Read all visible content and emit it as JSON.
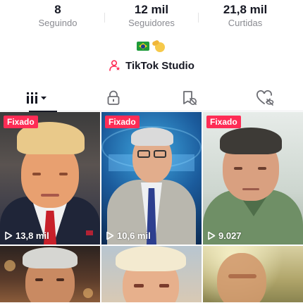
{
  "stats": [
    {
      "value": "8",
      "label": "Seguindo"
    },
    {
      "value": "12 mil",
      "label": "Seguidores"
    },
    {
      "value": "21,8 mil",
      "label": "Curtidas"
    }
  ],
  "bio_emojis": [
    "brazil-flag",
    "saluting-face"
  ],
  "studio": {
    "label": "TikTok Studio",
    "icon": "person-star-icon",
    "icon_color": "#fe2c55"
  },
  "tabs": [
    {
      "name": "videos",
      "icon": "grid-dropdown-icon",
      "active": true
    },
    {
      "name": "private",
      "icon": "lock-icon",
      "active": false
    },
    {
      "name": "reposts",
      "icon": "repost-icon",
      "active": false
    },
    {
      "name": "liked",
      "icon": "heart-hidden-icon",
      "active": false
    }
  ],
  "videos": [
    {
      "pinned_label": "Fixado",
      "views": "13,8 mil"
    },
    {
      "pinned_label": "Fixado",
      "views": "10,6 mil"
    },
    {
      "pinned_label": "Fixado",
      "views": "9.027"
    },
    {
      "pinned_label": "",
      "views": ""
    },
    {
      "pinned_label": "",
      "views": ""
    },
    {
      "pinned_label": "",
      "views": ""
    }
  ],
  "colors": {
    "accent": "#fe2c55",
    "text_primary": "#161823",
    "text_secondary": "#8a8b91"
  }
}
